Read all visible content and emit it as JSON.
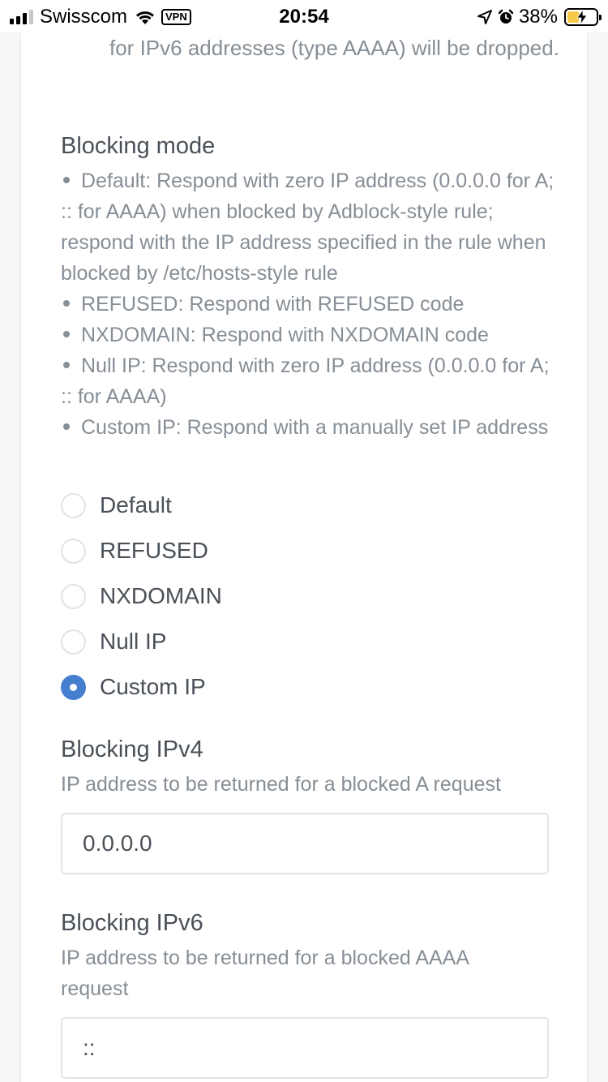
{
  "status_bar": {
    "carrier": "Swisscom",
    "vpn": "VPN",
    "time": "20:54",
    "battery": "38%"
  },
  "top_text": "for IPv6 addresses (type AAAA) will be dropped.",
  "blocking_mode": {
    "title": "Blocking mode",
    "desc_items": [
      "Default: Respond with zero IP address (0.0.0.0 for A; :: for AAAA) when blocked by Adblock-style rule; respond with the IP address specified in the rule when blocked by /etc/hosts-style rule",
      "REFUSED: Respond with REFUSED code",
      "NXDOMAIN: Respond with NXDOMAIN code",
      "Null IP: Respond with zero IP address (0.0.0.0 for A; :: for AAAA)",
      "Custom IP: Respond with a manually set IP address"
    ],
    "options": [
      {
        "label": "Default",
        "checked": false
      },
      {
        "label": "REFUSED",
        "checked": false
      },
      {
        "label": "NXDOMAIN",
        "checked": false
      },
      {
        "label": "Null IP",
        "checked": false
      },
      {
        "label": "Custom IP",
        "checked": true
      }
    ]
  },
  "blocking_ipv4": {
    "title": "Blocking IPv4",
    "desc": "IP address to be returned for a blocked A request",
    "value": "0.0.0.0"
  },
  "blocking_ipv6": {
    "title": "Blocking IPv6",
    "desc": "IP address to be returned for a blocked AAAA request",
    "value": "::"
  },
  "colors": {
    "accent": "#467fcf",
    "muted_text": "#868e96",
    "text": "#495057"
  }
}
